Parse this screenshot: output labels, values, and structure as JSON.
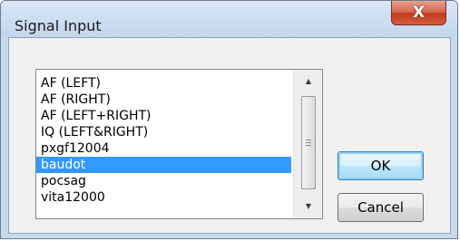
{
  "window": {
    "title": "Signal Input"
  },
  "titlebar": {
    "close_glyph": "X",
    "close_icon": "close-icon"
  },
  "list": {
    "items": [
      "AF (LEFT)",
      "AF (RIGHT)",
      "AF (LEFT+RIGHT)",
      "IQ (LEFT&RIGHT)",
      "pxgf12004",
      "baudot",
      "pocsag",
      "vita12000"
    ],
    "selected_item": "baudot",
    "selection_color": "#3399ff"
  },
  "scrollbar": {
    "up_icon": "arrow-up-icon",
    "down_icon": "arrow-down-icon"
  },
  "buttons": {
    "ok_label": "OK",
    "cancel_label": "Cancel"
  }
}
